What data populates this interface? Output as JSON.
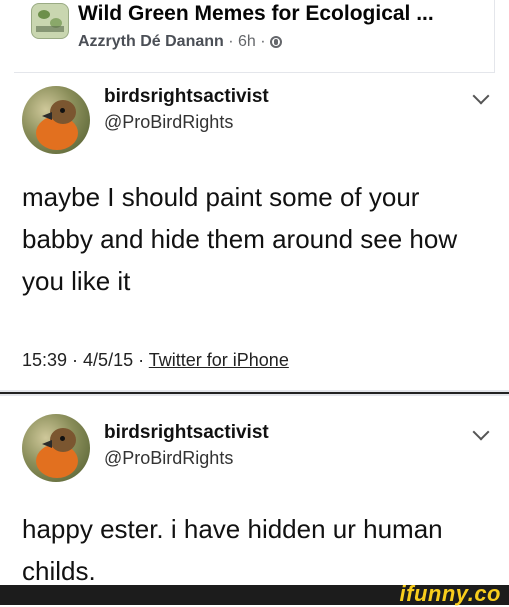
{
  "post": {
    "group_title": "Wild Green Memes for Ecological ...",
    "author": "Azzryth Dé Danann",
    "time_sep": " · 6h · ",
    "visibility_icon": "globe-icon"
  },
  "tweets": [
    {
      "display_name": "birdsrightsactivist",
      "handle": "@ProBirdRights",
      "text": "maybe I should paint some of your babby and hide them around see how you like it",
      "time": "15:39 · 4/5/15 · ",
      "source": "Twitter for iPhone"
    },
    {
      "display_name": "birdsrightsactivist",
      "handle": "@ProBirdRights",
      "text": "happy ester. i have hidden ur human childs."
    }
  ],
  "watermark": {
    "logo": "ifunny.co",
    "color": "#f8cd1c"
  }
}
